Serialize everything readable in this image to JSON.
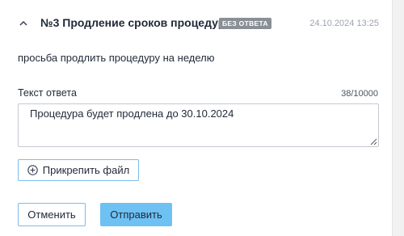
{
  "question": {
    "title": "№3 Продление сроков процедуры",
    "status_badge": "БЕЗ ОТВЕТА",
    "timestamp": "24.10.2024 13:25",
    "text": "просьба продлить процедуру на неделю"
  },
  "answer": {
    "label": "Текст ответа",
    "counter": "38/10000",
    "value": "Процедура будет продлена до 30.10.2024"
  },
  "actions": {
    "attach_label": "Прикрепить файл",
    "cancel_label": "Отменить",
    "send_label": "Отправить"
  },
  "icons": {
    "collapse": "chevron-up-icon",
    "attach": "plus-circle-icon",
    "resize": "resize-grip-icon"
  },
  "colors": {
    "badge_bg": "#8a8f96",
    "primary": "#6ec1f3",
    "outline": "#7dbbea"
  }
}
